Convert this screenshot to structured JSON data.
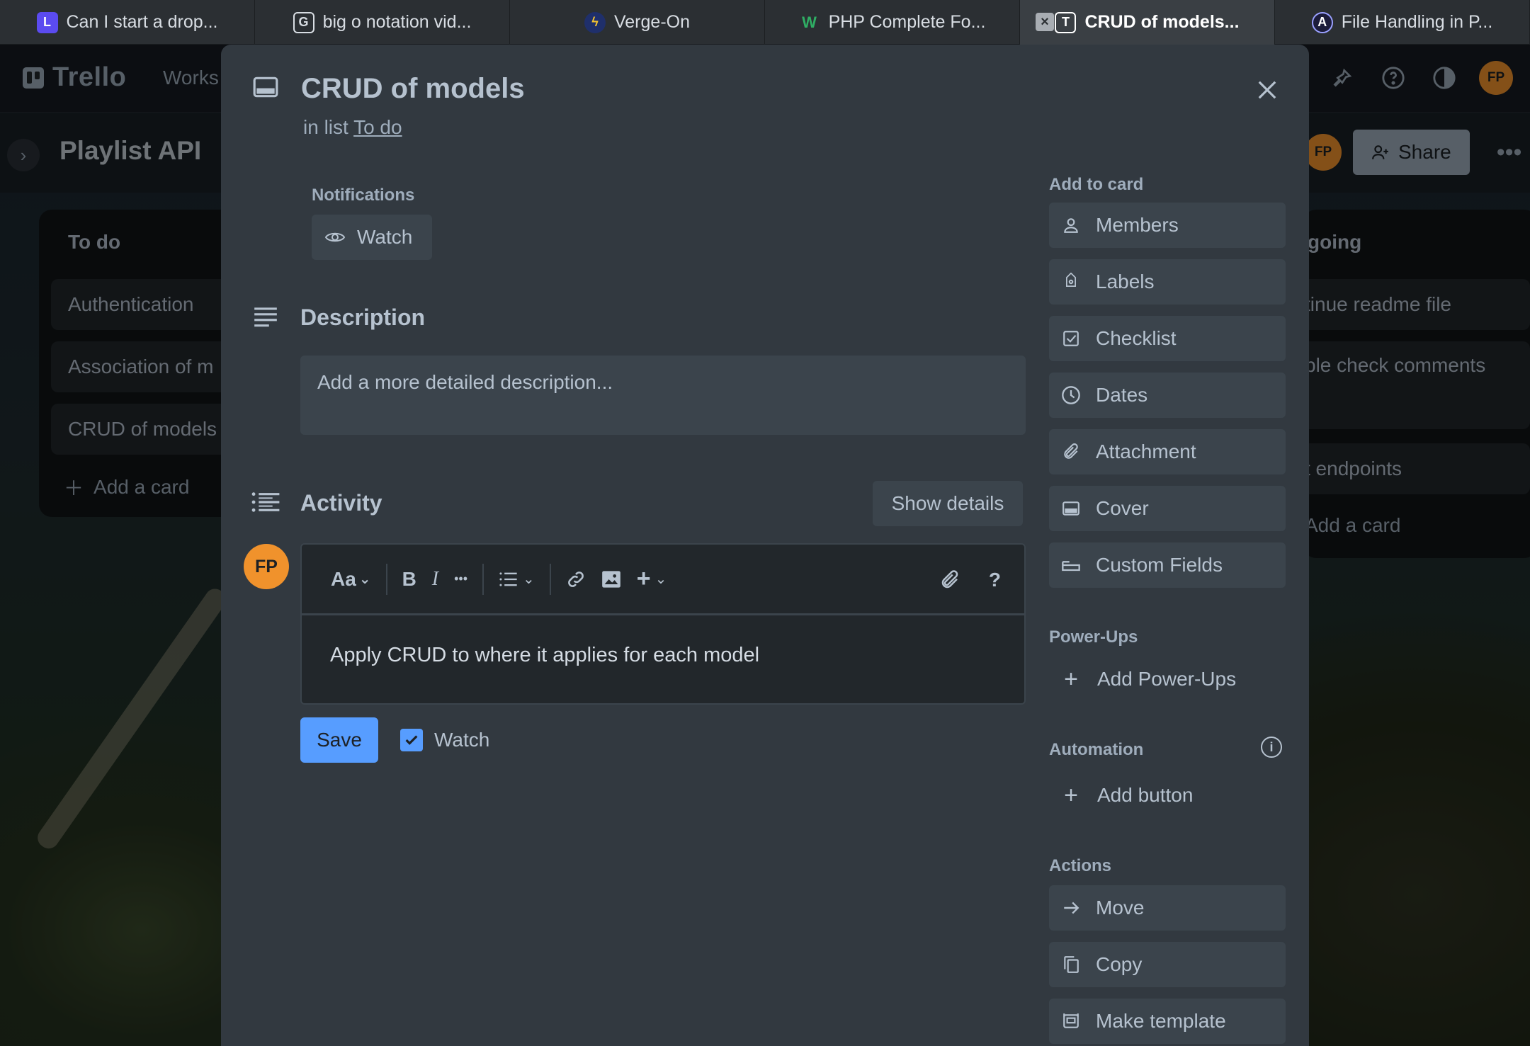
{
  "browser": {
    "tabs": [
      {
        "title": "Can I start a drop...",
        "favicon": "L",
        "favicon_color": "#5b4bf0"
      },
      {
        "title": "big o notation vid...",
        "favicon": "G",
        "favicon_color": "#2b2f33"
      },
      {
        "title": "Verge-On",
        "favicon": "verge-icon",
        "favicon_color": "#f2c230"
      },
      {
        "title": "PHP Complete Fo...",
        "favicon": "W",
        "favicon_color": "#2fae64"
      },
      {
        "title": "CRUD of models...",
        "favicon": "T",
        "favicon_color": "#2b2f33",
        "active": true
      },
      {
        "title": "File Handling in P...",
        "favicon": "A",
        "favicon_color": "#1c1c3a"
      }
    ]
  },
  "header": {
    "logo": "Trello",
    "workspaces": "Works",
    "avatar_initials": "FP"
  },
  "board": {
    "title": "Playlist API",
    "share_label": "Share",
    "member_initials": "FP",
    "left_list": {
      "title": "To do",
      "cards": [
        "Authentication",
        "Association of m",
        "CRUD of models"
      ],
      "add_card": "Add a card"
    },
    "right_list": {
      "title": "going",
      "cards": [
        "tinue readme file",
        "ble check comments",
        "t endpoints"
      ],
      "add_card": "Add a card"
    }
  },
  "card": {
    "title": "CRUD of models",
    "in_list_prefix": "in list",
    "list_name": "To do",
    "notifications_label": "Notifications",
    "watch_label": "Watch",
    "description_heading": "Description",
    "description_placeholder": "Add a more detailed description...",
    "activity_heading": "Activity",
    "show_details": "Show details",
    "commenter_initials": "FP",
    "editor_text": "Apply CRUD to where it applies for each model",
    "toolbar": {
      "text_style": "Aa",
      "bold": "B",
      "italic": "I",
      "more": "•••",
      "help": "?"
    },
    "save_label": "Save",
    "watch_checkbox_label": "Watch"
  },
  "sidebar": {
    "add_to_card_heading": "Add to card",
    "add_to_card": [
      "Members",
      "Labels",
      "Checklist",
      "Dates",
      "Attachment",
      "Cover",
      "Custom Fields"
    ],
    "powerups_heading": "Power-Ups",
    "add_powerups": "Add Power-Ups",
    "automation_heading": "Automation",
    "add_button": "Add button",
    "actions_heading": "Actions",
    "actions": [
      "Move",
      "Copy",
      "Make template"
    ]
  },
  "colors": {
    "accent": "#579dff",
    "avatar": "#f0922c",
    "modal_bg": "#323940",
    "button_bg": "#3b444c"
  }
}
